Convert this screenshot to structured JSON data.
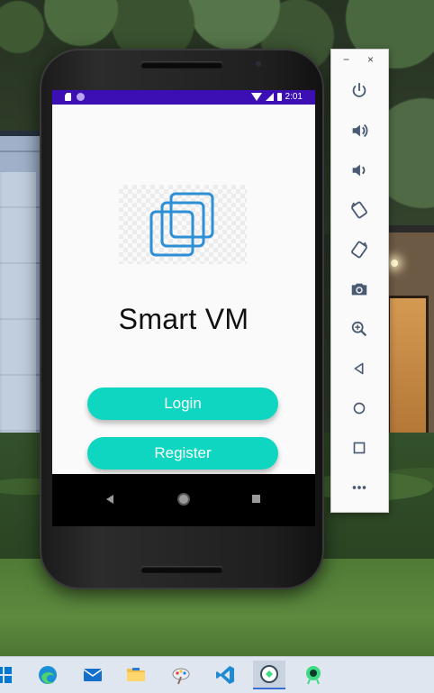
{
  "statusbar": {
    "time": "2:01"
  },
  "app": {
    "title": "Smart VM",
    "login_label": "Login",
    "register_label": "Register",
    "accent": "#0fd6c0",
    "logo_color": "#2d8fd5",
    "statusbar_color": "#3b0fb3"
  },
  "toolbar": {
    "minimize": "−",
    "close": "×",
    "items": [
      "power",
      "volume-up",
      "volume-down",
      "rotate-left",
      "rotate-right",
      "screenshot",
      "zoom",
      "back",
      "home",
      "overview",
      "more"
    ]
  },
  "taskbar": {
    "items": [
      "start",
      "edge",
      "mail",
      "file-explorer",
      "paint",
      "vscode",
      "emulator",
      "android-studio"
    ]
  }
}
